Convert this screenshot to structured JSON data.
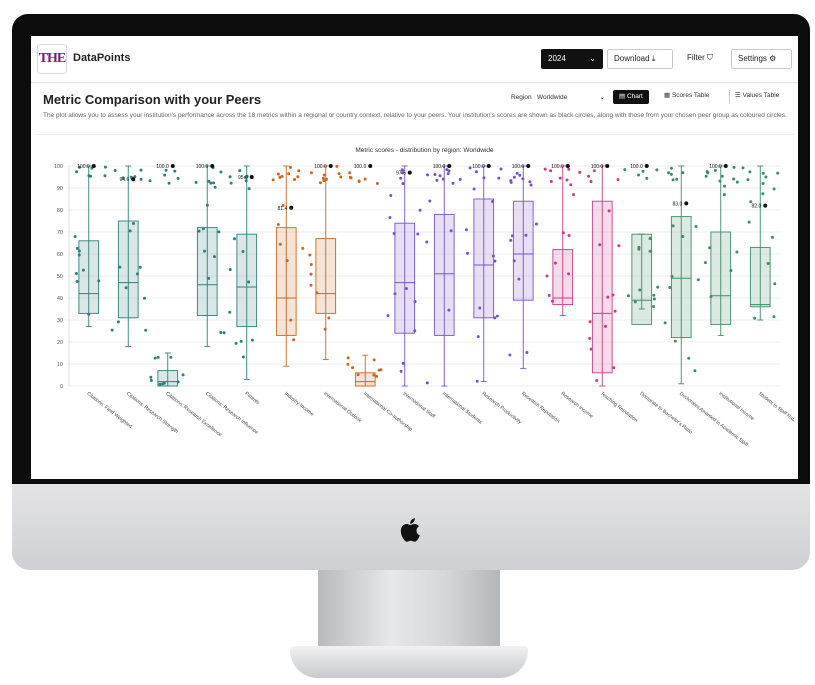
{
  "app": {
    "logo_text": "THE",
    "name": "DataPoints",
    "year_select": "2024",
    "download_label": "Download",
    "filter_label": "Filter",
    "settings_label": "Settings"
  },
  "page": {
    "title": "Metric Comparison with your Peers",
    "description": "The plot allows you to assess your institution's performance across the 18 metrics within a regional or country context, relative to your peers. Your institution's scores are shown as black circles, along with those from your chosen peer group as coloured circles."
  },
  "controls": {
    "region_label": "Region",
    "region_value": "Worldwide",
    "view_chart": "Chart",
    "view_scores_table": "Scores Table",
    "view_values_table": "Values Table"
  },
  "chart_data": {
    "type": "box",
    "title": "Metric scores - distribution by region: Worldwide",
    "ylim": [
      0,
      100
    ],
    "yticks": [
      0,
      10,
      20,
      30,
      40,
      50,
      60,
      70,
      80,
      90,
      100
    ],
    "grid": true,
    "categories": [
      "Citations: Field Weighted",
      "Citations: Research Strength",
      "Citations: Research Excellence",
      "Citations: Research Influence",
      "Patents",
      "Industry Income",
      "International Outlook",
      "International Co-authorship",
      "International Staff",
      "International Students",
      "Research Productivity",
      "Research Reputation",
      "Research Income",
      "Teaching Reputation",
      "Doctorate to Bachelor's Ratio",
      "Doctorates Awarded to Academic Staff",
      "Institutional Income",
      "Student to Staff Ratio"
    ],
    "category_colors": [
      "#2f7f7b",
      "#2f7f7b",
      "#2f7f7b",
      "#2f7f7b",
      "#2f7f7b",
      "#c9671f",
      "#c9671f",
      "#c9671f",
      "#7a52c7",
      "#7a52c7",
      "#7a52c7",
      "#7a52c7",
      "#c73b8c",
      "#c73b8c",
      "#3d8d63",
      "#3d8d63",
      "#3d8d63",
      "#3d8d63"
    ],
    "boxes": [
      {
        "min": 27,
        "q1": 33,
        "median": 42,
        "q3": 66,
        "max": 100
      },
      {
        "min": 18,
        "q1": 31,
        "median": 47,
        "q3": 75,
        "max": 100
      },
      {
        "min": 0,
        "q1": 0,
        "median": 2,
        "q3": 7,
        "max": 15
      },
      {
        "min": 18,
        "q1": 32,
        "median": 46,
        "q3": 72,
        "max": 100
      },
      {
        "min": 3,
        "q1": 27,
        "median": 45,
        "q3": 69,
        "max": 100
      },
      {
        "min": 9,
        "q1": 23,
        "median": 40,
        "q3": 72,
        "max": 100
      },
      {
        "min": 12,
        "q1": 33,
        "median": 42,
        "q3": 67,
        "max": 100
      },
      {
        "min": 0,
        "q1": 0,
        "median": 2,
        "q3": 6,
        "max": 14
      },
      {
        "min": 0,
        "q1": 24,
        "median": 47,
        "q3": 74,
        "max": 100
      },
      {
        "min": 0,
        "q1": 23,
        "median": 51,
        "q3": 78,
        "max": 100
      },
      {
        "min": 2,
        "q1": 31,
        "median": 55,
        "q3": 85,
        "max": 100
      },
      {
        "min": 8,
        "q1": 39,
        "median": 60,
        "q3": 84,
        "max": 100
      },
      {
        "min": 32,
        "q1": 37,
        "median": 40,
        "q3": 62,
        "max": 100
      },
      {
        "min": 0,
        "q1": 6,
        "median": 33,
        "q3": 84,
        "max": 100
      },
      {
        "min": 35,
        "q1": 28,
        "median": 39,
        "q3": 69,
        "max": 69
      },
      {
        "min": 1,
        "q1": 22,
        "median": 49,
        "q3": 77,
        "max": 100
      },
      {
        "min": 23,
        "q1": 28,
        "median": 41,
        "q3": 70,
        "max": 100
      },
      {
        "min": 30,
        "q1": 36,
        "median": 37,
        "q3": 63,
        "max": 100
      }
    ],
    "institution_scores": [
      100,
      94,
      100,
      100,
      95,
      81,
      100,
      100,
      97,
      100,
      100,
      100,
      100,
      100,
      100,
      83,
      100,
      82
    ],
    "institution_score_labels": [
      "100.0",
      "94.6",
      "100.0",
      "100.0",
      "95.0",
      "81.4",
      "100.0",
      "100.0",
      "97.5",
      "100.0",
      "100.0",
      "100.0",
      "100.0",
      "100.0",
      "100.0",
      "83.0",
      "100.0",
      "82.0"
    ]
  }
}
